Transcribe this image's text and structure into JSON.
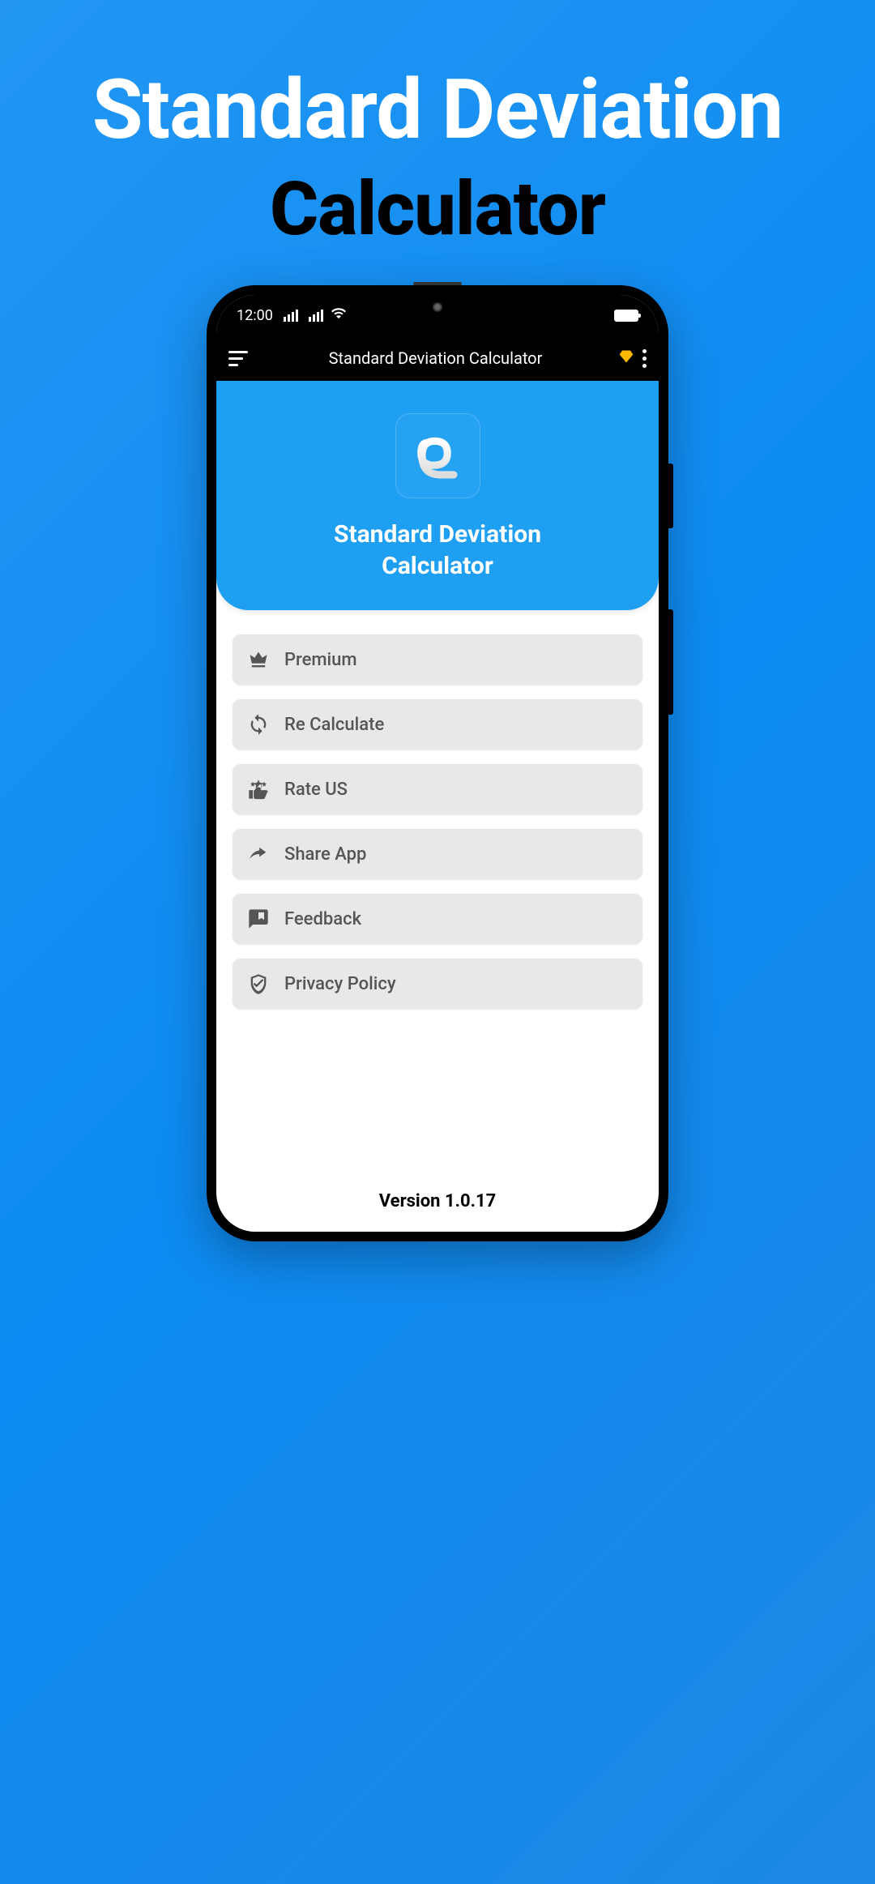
{
  "promo": {
    "line1": "Standard Deviation",
    "line2": "Calculator"
  },
  "statusBar": {
    "time": "12:00"
  },
  "appBar": {
    "title": "Standard Deviation Calculator"
  },
  "hero": {
    "title_line1": "Standard Deviation",
    "title_line2": "Calculator"
  },
  "menu": {
    "items": [
      {
        "icon": "crown",
        "label": "Premium"
      },
      {
        "icon": "refresh",
        "label": "Re Calculate"
      },
      {
        "icon": "rate",
        "label": "Rate US"
      },
      {
        "icon": "share",
        "label": "Share App"
      },
      {
        "icon": "feedback",
        "label": "Feedback"
      },
      {
        "icon": "shield",
        "label": "Privacy Policy"
      }
    ]
  },
  "version": "Version 1.0.17"
}
